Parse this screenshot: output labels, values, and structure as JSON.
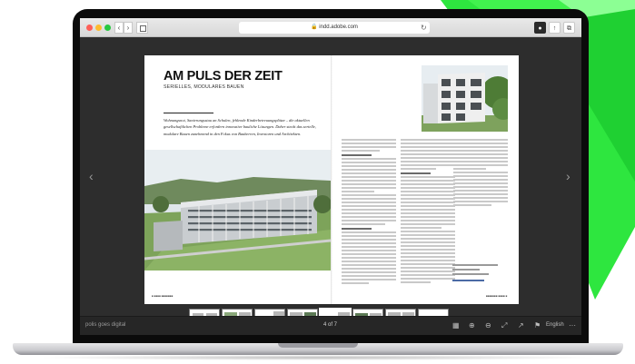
{
  "browser": {
    "address": "🔒 indd.adobe.com",
    "nav_back": "‹",
    "nav_forward": "›",
    "reload_icon": "↻",
    "shield_icon": "●",
    "share_icon": "↑",
    "tabs_icon": "⧉"
  },
  "document": {
    "title": "AM PULS DER ZEIT",
    "subtitle": "SERIELLES, MODULARES BAUEN",
    "intro": "Wohnungsnot, Sanierungsstau an Schulen, fehlende Kinderbetreuungsplätze – die aktuellen gesellschaftlichen Probleme erfordern innovative bauliche Lösungen. Daher steckt das serielle, modulare Bauen zunehmend in den Fokus von Bauherren, Investoren und Architekten."
  },
  "toolbar": {
    "brand": "polis goes digital",
    "page": "4 of 7",
    "language": "English",
    "prev_arrow": "‹",
    "next_arrow": "›",
    "grid_icon": "▦",
    "zoom_in_icon": "⊕",
    "zoom_out_icon": "⊖",
    "fullscreen_icon": "⤢",
    "share_icon": "↗",
    "flag_icon": "⚑",
    "more_icon": "···"
  },
  "colors": {
    "accent_green": "#22ff3c",
    "viewer_bg": "#2d2d2d",
    "toolbar_bg": "#262626"
  }
}
